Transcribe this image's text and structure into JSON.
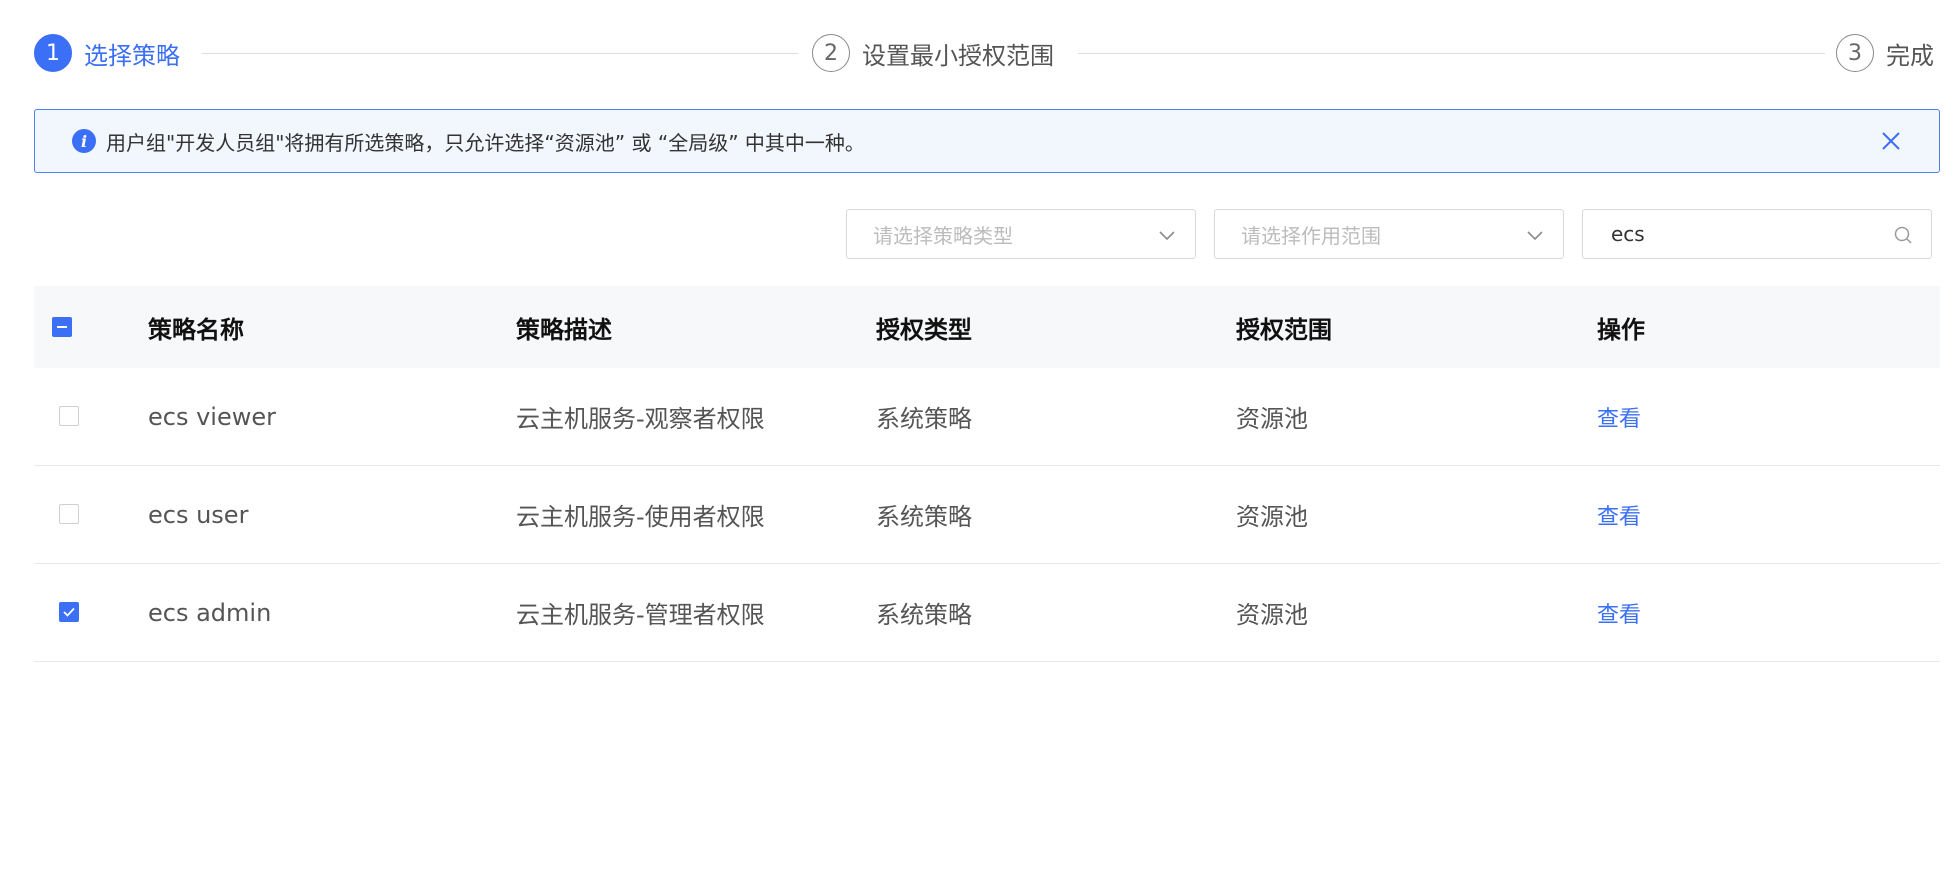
{
  "steps": [
    {
      "number": "1",
      "label": "选择策略",
      "active": true
    },
    {
      "number": "2",
      "label": "设置最小授权范围",
      "active": false
    },
    {
      "number": "3",
      "label": "完成",
      "active": false
    }
  ],
  "alert": {
    "icon": "info-icon",
    "text": "用户组\"开发人员组\"将拥有所选策略，只允许选择“资源池” 或 “全局级” 中其中一种。",
    "close_icon": "close-icon"
  },
  "filters": {
    "policy_type_placeholder": "请选择策略类型",
    "scope_placeholder": "请选择作用范围",
    "search_value": "ecs"
  },
  "table": {
    "headers": [
      "策略名称",
      "策略描述",
      "授权类型",
      "授权范围",
      "操作"
    ],
    "header_checkbox": "indeterminate",
    "rows": [
      {
        "checked": false,
        "name": "ecs viewer",
        "desc": "云主机服务-观察者权限",
        "type": "系统策略",
        "scope": "资源池",
        "action": "查看"
      },
      {
        "checked": false,
        "name": "ecs user",
        "desc": "云主机服务-使用者权限",
        "type": "系统策略",
        "scope": "资源池",
        "action": "查看"
      },
      {
        "checked": true,
        "name": "ecs admin",
        "desc": "云主机服务-管理者权限",
        "type": "系统策略",
        "scope": "资源池",
        "action": "查看"
      }
    ]
  },
  "colors": {
    "primary": "#3b6ff5",
    "alert_bg": "#f2f6fd",
    "header_bg": "#f7f8fa"
  }
}
